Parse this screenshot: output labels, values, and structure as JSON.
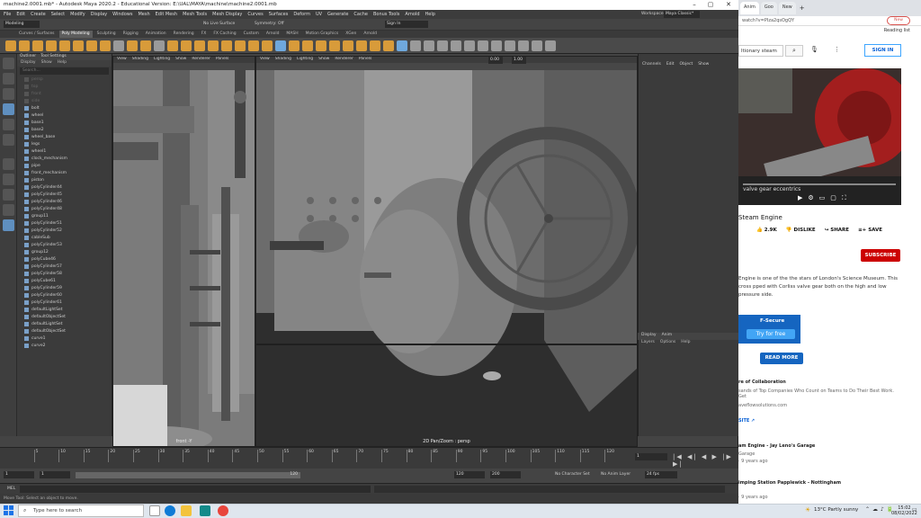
{
  "maya": {
    "title": "machine2.0001.mb* - Autodesk Maya 2020.2 - Educational Version: E:\\UAL\\MAYA\\machine\\machine2.0001.mb",
    "menu": [
      "File",
      "Edit",
      "Create",
      "Select",
      "Modify",
      "Display",
      "Windows",
      "Mesh",
      "Edit Mesh",
      "Mesh Tools",
      "Mesh Display",
      "Curves",
      "Surfaces",
      "Deform",
      "UV",
      "Generate",
      "Cache",
      "Bonus Tools",
      "Arnold",
      "Help"
    ],
    "workspace_label": "Workspace:",
    "workspace_value": "Maya Classic*",
    "mode": "Modeling",
    "live_surface": "No Live Surface",
    "symmetry": "Symmetry: Off",
    "sign_in": "Sign In",
    "shelf_tabs": [
      "Curves / Surfaces",
      "Poly Modeling",
      "Sculpting",
      "Rigging",
      "Animation",
      "Rendering",
      "FX",
      "FX Caching",
      "Custom",
      "Arnold",
      "MASH",
      "Motion Graphics",
      "XGen",
      "Arnold"
    ],
    "shelf_active": "Poly Modeling",
    "outliner": {
      "tabs": [
        "Outliner",
        "Tool Settings"
      ],
      "menu": [
        "Display",
        "Show",
        "Help"
      ],
      "search_placeholder": "Search...",
      "items": [
        "persp",
        "top",
        "front",
        "side",
        "bolt",
        "wheel",
        "base1",
        "base2",
        "wheel_base",
        "legs",
        "wheel1",
        "clock_mechanism",
        "pipe",
        "front_mechanism",
        "piston",
        "polyCylinder44",
        "polyCylinder45",
        "polyCylinder46",
        "polyCylinder48",
        "group11",
        "polyCylinder51",
        "polyCylinder52",
        "cableSub",
        "polyCylinder53",
        "group12",
        "polyCube46",
        "polyCylinder57",
        "polyCylinder58",
        "polyCube61",
        "polyCylinder59",
        "polyCylinder60",
        "polyCylinder61",
        "defaultLightSet",
        "defaultObjectSet",
        "defaultLightSet",
        "defaultObjectSet",
        "curve1",
        "curve2"
      ]
    },
    "viewport_menu": [
      "View",
      "Shading",
      "Lighting",
      "Show",
      "Renderer",
      "Panels"
    ],
    "viewport_left_label": "front -Y",
    "viewport_right_label": "2D Pan/Zoom : persp",
    "viewport_fields": [
      "0.00",
      "1.00"
    ],
    "channels_menu": [
      "Channels",
      "Edit",
      "Object",
      "Show"
    ],
    "layer_tabs": [
      "Display",
      "Anim"
    ],
    "layer_menu": [
      "Layers",
      "Options",
      "Help"
    ],
    "timeline_ticks": [
      "5",
      "10",
      "15",
      "20",
      "25",
      "30",
      "35",
      "40",
      "45",
      "50",
      "55",
      "60",
      "65",
      "70",
      "75",
      "80",
      "85",
      "90",
      "95",
      "100",
      "105",
      "110",
      "115",
      "120"
    ],
    "current_frame": "1",
    "range_start": "1",
    "range_start2": "1",
    "range_mid": "120",
    "range_end": "120",
    "range_end2": "200",
    "character_set": "No Character Set",
    "anim_layer": "No Anim Layer",
    "fps": "24 fps",
    "cmd_label": "MEL",
    "help_line": "Move Tool: Select an object to move."
  },
  "browser": {
    "tabs": [
      "Anim",
      "Goo",
      "New"
    ],
    "active_tab": "Anim",
    "address": "watch?v=PIza2qsOgQY",
    "new_button": "New",
    "bookmarks": "Reading list",
    "search_text": "ltionary steam",
    "sign_in": "SIGN IN",
    "video_caption": "valve gear eccentrics",
    "video_title": "Steam Engine",
    "likes": "2.9K",
    "dislike": "DISLIKE",
    "share": "SHARE",
    "save": "SAVE",
    "subscribe": "SUBSCRIBE",
    "description": "Engine is one of the the stars of London's Science Museum. This cross pped with Corliss valve gear both on the high and low pressure side.",
    "ad_brand": "F-Secure",
    "ad_cta": "Try for free",
    "read_more": "READ MORE",
    "promo_title": "re of Collaboration",
    "promo_text": "sands of Top Companies Who Count on Teams to Do Their Best Work. Get",
    "promo_domain": "aveflowsolutions.com",
    "promo_site": "SITE",
    "rec1_title": "am Engine - Jay Leno's Garage",
    "rec1_channel": "Garage",
    "rec1_meta": "· 9 years ago",
    "rec2_title": "imping Station Papplewick - Nottingham",
    "rec2_meta": "· 9 years ago"
  },
  "taskbar": {
    "search_placeholder": "Type here to search",
    "weather": "13°C  Partly sunny",
    "time": "15:02",
    "date": "08/02/2022"
  }
}
